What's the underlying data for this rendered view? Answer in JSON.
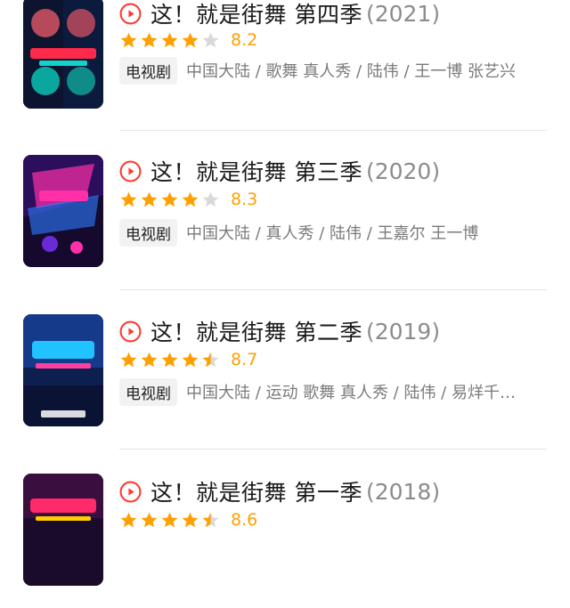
{
  "items": [
    {
      "title": "这！就是街舞 第四季",
      "year": "(2021)",
      "rating": 8.2,
      "stars": 4,
      "rating_text": "8.2",
      "badge": "电视剧",
      "meta": "中国大陆 / 歌舞 真人秀 / 陆伟 / 王一博 张艺兴",
      "poster_colors": [
        "#0a1b3d",
        "#ff2a4a",
        "#14d2c8"
      ],
      "icon": "play-circle-icon"
    },
    {
      "title": "这！就是街舞 第三季",
      "year": "(2020)",
      "rating": 8.3,
      "stars": 4,
      "rating_text": "8.3",
      "badge": "电视剧",
      "meta": "中国大陆 / 真人秀 / 陆伟 / 王嘉尔 王一博",
      "poster_colors": [
        "#150a2e",
        "#ff2fa8",
        "#2f7bff"
      ],
      "icon": "play-circle-icon"
    },
    {
      "title": "这！就是街舞 第二季",
      "year": "(2019)",
      "rating": 8.7,
      "stars": 4.5,
      "rating_text": "8.7",
      "badge": "电视剧",
      "meta": "中国大陆 / 运动 歌舞 真人秀 / 陆伟 / 易烊千…",
      "poster_colors": [
        "#0d1f4f",
        "#21c3ff",
        "#ff3fa0"
      ],
      "icon": "play-circle-icon"
    },
    {
      "title": "这！就是街舞 第一季",
      "year": "(2018)",
      "rating": 8.6,
      "stars": 4.5,
      "rating_text": "8.6",
      "badge": "",
      "meta": "",
      "poster_colors": [
        "#1a0b2a",
        "#ff2a6a",
        "#ffcc00"
      ],
      "icon": "play-circle-icon"
    }
  ],
  "colors": {
    "accent": "#ff3b30",
    "star": "#ff9f00",
    "star_empty": "#d9d9d9"
  }
}
